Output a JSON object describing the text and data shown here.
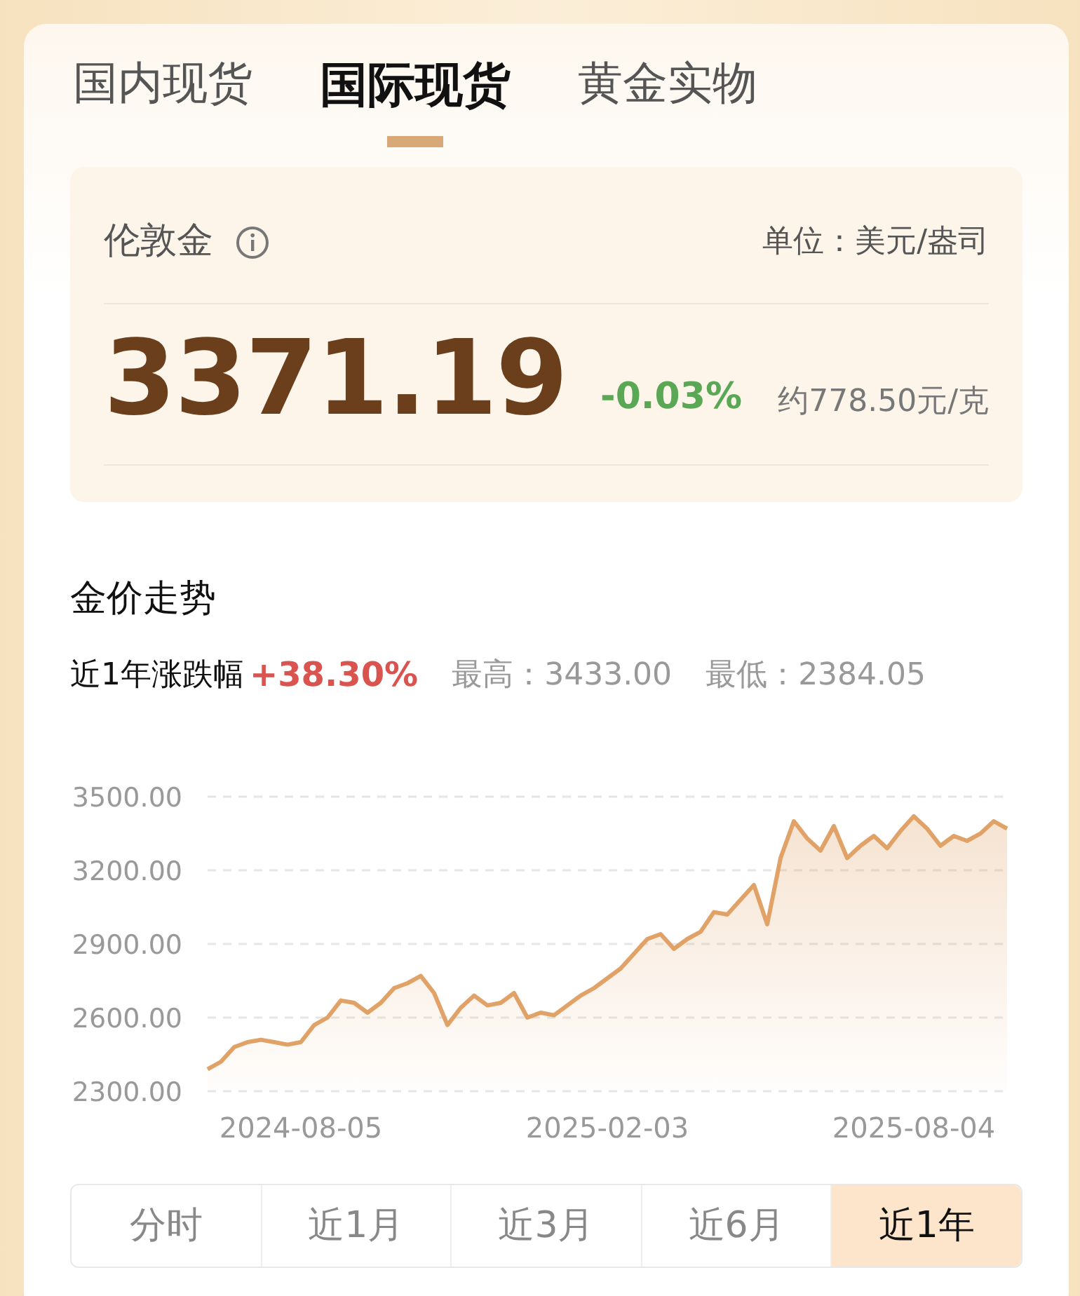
{
  "tabs": [
    {
      "label": "国内现货",
      "selected": false
    },
    {
      "label": "国际现货",
      "selected": true
    },
    {
      "label": "黄金实物",
      "selected": false
    }
  ],
  "quote": {
    "name": "伦敦金",
    "unit": "单位：美元/盎司",
    "price": "3371.19",
    "change": "-0.03%",
    "approx": "约778.50元/克"
  },
  "trend": {
    "title": "金价走势",
    "range_label": "近1年涨跌幅",
    "range_change": "+38.30%",
    "high": "最高：3433.00",
    "low": "最低：2384.05",
    "chart_data": {
      "type": "area",
      "categories": [
        null,
        null,
        null,
        null,
        null,
        null,
        null,
        "2024-08-05",
        null,
        null,
        null,
        null,
        null,
        null,
        null,
        null,
        null,
        null,
        null,
        null,
        null,
        null,
        null,
        null,
        null,
        null,
        null,
        null,
        null,
        null,
        "2025-02-03",
        null,
        null,
        null,
        null,
        null,
        null,
        null,
        null,
        null,
        null,
        null,
        null,
        null,
        null,
        null,
        null,
        null,
        null,
        null,
        null,
        null,
        null,
        "2025-08-04",
        null,
        null,
        null,
        null,
        null,
        null,
        null
      ],
      "series": [
        {
          "color": "#e0a267",
          "values": [
            2390,
            2420,
            2480,
            2500,
            2510,
            2500,
            2490,
            2500,
            2570,
            2600,
            2670,
            2660,
            2620,
            2660,
            2720,
            2740,
            2770,
            2700,
            2570,
            2640,
            2690,
            2650,
            2660,
            2700,
            2600,
            2620,
            2610,
            2650,
            2690,
            2720,
            2760,
            2800,
            2860,
            2920,
            2940,
            2880,
            2920,
            2950,
            3030,
            3020,
            3080,
            3140,
            2980,
            3250,
            3400,
            3330,
            3280,
            3380,
            3250,
            3300,
            3340,
            3290,
            3360,
            3420,
            3370,
            3300,
            3340,
            3320,
            3350,
            3400,
            3370
          ]
        }
      ],
      "ylim": [
        2300,
        3500
      ],
      "grid": true,
      "yticks": [
        {
          "value": 2300,
          "label": "2300.00"
        },
        {
          "value": 2600,
          "label": "2600.00"
        },
        {
          "value": 2900,
          "label": "2900.00"
        },
        {
          "value": 3200,
          "label": "3200.00"
        },
        {
          "value": 3500,
          "label": "3500.00"
        }
      ]
    }
  },
  "periods": [
    {
      "label": "分时",
      "selected": false
    },
    {
      "label": "近1月",
      "selected": false
    },
    {
      "label": "近3月",
      "selected": false
    },
    {
      "label": "近6月",
      "selected": false
    },
    {
      "label": "近1年",
      "selected": true
    }
  ]
}
